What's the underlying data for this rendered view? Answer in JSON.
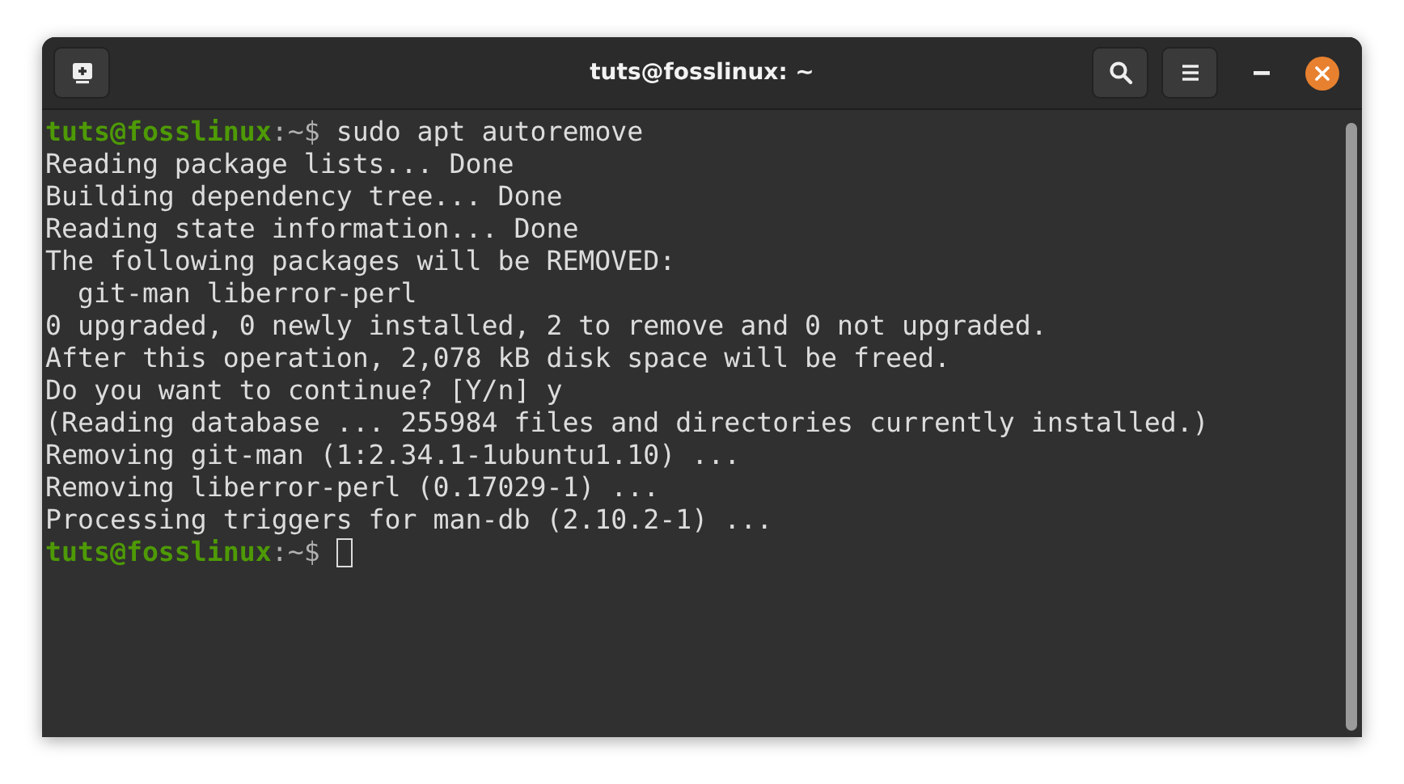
{
  "window": {
    "title": "tuts@fosslinux: ~"
  },
  "terminal": {
    "lines": [
      {
        "kind": "prompt",
        "user_host": "tuts@fosslinux",
        "path": ":~$",
        "command": " sudo apt autoremove"
      },
      {
        "kind": "output",
        "text": "Reading package lists... Done"
      },
      {
        "kind": "output",
        "text": "Building dependency tree... Done"
      },
      {
        "kind": "output",
        "text": "Reading state information... Done"
      },
      {
        "kind": "output",
        "text": "The following packages will be REMOVED:"
      },
      {
        "kind": "output",
        "text": "  git-man liberror-perl"
      },
      {
        "kind": "output",
        "text": "0 upgraded, 0 newly installed, 2 to remove and 0 not upgraded."
      },
      {
        "kind": "output",
        "text": "After this operation, 2,078 kB disk space will be freed."
      },
      {
        "kind": "output",
        "text": "Do you want to continue? [Y/n] y"
      },
      {
        "kind": "output",
        "text": "(Reading database ... 255984 files and directories currently installed.)"
      },
      {
        "kind": "output",
        "text": "Removing git-man (1:2.34.1-1ubuntu1.10) ..."
      },
      {
        "kind": "output",
        "text": "Removing liberror-perl (0.17029-1) ..."
      },
      {
        "kind": "output",
        "text": "Processing triggers for man-db (2.10.2-1) ..."
      },
      {
        "kind": "prompt",
        "user_host": "tuts@fosslinux",
        "path": ":~$",
        "cursor": true
      }
    ]
  }
}
